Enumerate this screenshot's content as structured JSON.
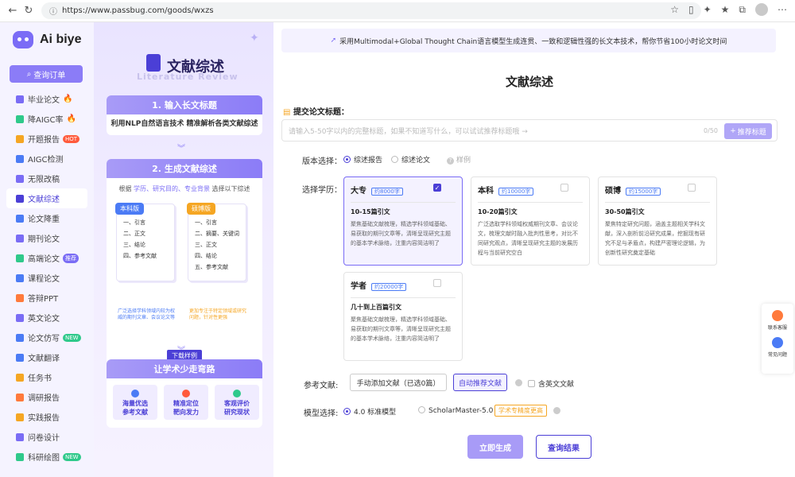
{
  "browser": {
    "url": "https://www.passbug.com/goods/wxzs"
  },
  "sidebar": {
    "logo_text": "Ai biye",
    "order_button": "查询订单",
    "items": [
      {
        "label": "毕业论文",
        "color": "#7a6cf5",
        "badge": "fire"
      },
      {
        "label": "降AIGC率",
        "color": "#2fc98b",
        "badge": "fire"
      },
      {
        "label": "开题报告",
        "color": "#f5a623",
        "badge": "HOT"
      },
      {
        "label": "AIGC检测",
        "color": "#4b7bf5",
        "badge": ""
      },
      {
        "label": "无限改稿",
        "color": "#7a6cf5",
        "badge": ""
      },
      {
        "label": "文献综述",
        "color": "#4b3fd6",
        "badge": "",
        "active": true
      },
      {
        "label": "论文降重",
        "color": "#4b7bf5",
        "badge": ""
      },
      {
        "label": "期刊论文",
        "color": "#7a6cf5",
        "badge": ""
      },
      {
        "label": "高端论文",
        "color": "#2fc98b",
        "badge": "推荐"
      },
      {
        "label": "课程论文",
        "color": "#4b7bf5",
        "badge": ""
      },
      {
        "label": "答辩PPT",
        "color": "#ff7a3c",
        "badge": ""
      },
      {
        "label": "英文论文",
        "color": "#7a6cf5",
        "badge": ""
      },
      {
        "label": "论文仿写",
        "color": "#4b7bf5",
        "badge": "NEW"
      },
      {
        "label": "文献翻译",
        "color": "#4b7bf5",
        "badge": ""
      },
      {
        "label": "任务书",
        "color": "#f5a623",
        "badge": ""
      },
      {
        "label": "调研报告",
        "color": "#ff7a3c",
        "badge": ""
      },
      {
        "label": "实践报告",
        "color": "#f5a623",
        "badge": ""
      },
      {
        "label": "问卷设计",
        "color": "#7a6cf5",
        "badge": ""
      },
      {
        "label": "科研绘图",
        "color": "#2fc98b",
        "badge": "NEW"
      }
    ]
  },
  "promo": {
    "title": "文献综述",
    "subtitle": "Literature Review",
    "step1": {
      "head": "1. 输入长文标题",
      "text": "利用NLP自然语言技术  精准解析各类文献综述"
    },
    "step2": {
      "head": "2. 生成文献综述",
      "desc_pre": "根据 ",
      "desc_hl": "学历、研究目的、专业背景",
      "desc_post": " 选择以下综述",
      "paper_a": {
        "tag": "本科版",
        "lines": [
          "一、引言",
          "二、正文",
          "三、结论",
          "四、参考文献"
        ],
        "note": "广泛选择学科领域内较为权威的期刊文章、会议论文等"
      },
      "paper_b": {
        "tag": "硕博版",
        "lines": [
          "一、引言",
          "二、摘要、关键词",
          "三、正文",
          "四、结论",
          "五、参考文献"
        ],
        "note": "更加专注于特定领域或研究问题，针对性更强"
      },
      "download": "下载样例"
    },
    "step3": {
      "head": "让学术少走弯路",
      "features": [
        {
          "line1": "海量优选",
          "line2": "参考文献",
          "color": "#4b7bf5"
        },
        {
          "line1": "精准定位",
          "line2": "靶向发力",
          "color": "#ff5a3c"
        },
        {
          "line1": "客观评价",
          "line2": "研究现状",
          "color": "#2fc98b"
        }
      ]
    }
  },
  "main": {
    "notice": "采用Multimodal+Global Thought Chain语言模型生成连贯、一致和逻辑性强的长文本技术，帮你节省100小时论文时间",
    "title": "文献综述",
    "input_label": "提交论文标题：",
    "input_placeholder": "请输入5-50字以内的完整标题，如果不知道写什么，可以试试推荐标题哦 →",
    "input_count": "0/50",
    "recommend_button": "推荐标题",
    "version_label": "版本选择：",
    "version_options": [
      "综述报告",
      "综述论文"
    ],
    "sample_text": "样例",
    "edu_label": "选择学历：",
    "edu_cards": [
      {
        "name": "大专",
        "tag": "约8000字",
        "count": "10-15篇引文",
        "desc": "聚焦基础文献梳理，精选学科领域基础、易获取的期刊文章等，清晰呈现研究主题的基本学术脉络，注重内容简洁明了",
        "selected": true
      },
      {
        "name": "本科",
        "tag": "约10000字",
        "count": "10-20篇引文",
        "desc": "广泛选取学科领域权威期刊文章、会议论文，梳理文献时融入批判性思考，对比不同研究观点，清晰呈现研究主题的发展历程与当前研究空白",
        "selected": false
      },
      {
        "name": "硕博",
        "tag": "约15000字",
        "count": "30-50篇引文",
        "desc": "聚焦特定研究问题，涵盖主题相关学科文献，深入剖析前沿研究成果，挖掘现有研究不足与矛盾点，构建严密理论逻辑，为创新性研究奠定基础",
        "selected": false
      },
      {
        "name": "学者",
        "tag": "约20000字",
        "count": "几十到上百篇引文",
        "desc": "聚焦基础文献梳理，精选学科领域基础、易获取的期刊文章等，清晰呈现研究主题的基本学术脉络，注重内容简洁明了",
        "selected": false
      }
    ],
    "ref_label": "参考文献:",
    "ref_manual": "手动添加文献（已选0篇）",
    "ref_auto": "自动推荐文献",
    "ref_english": "含英文文献",
    "model_label": "模型选择:",
    "model_options": [
      "4.0 标准模型",
      "ScholarMaster-5.0"
    ],
    "model_tag": "学术专精度更高",
    "generate_button": "立即生成",
    "query_button": "查询结果",
    "float": {
      "service": "联系客服",
      "faq": "常见问题"
    }
  }
}
